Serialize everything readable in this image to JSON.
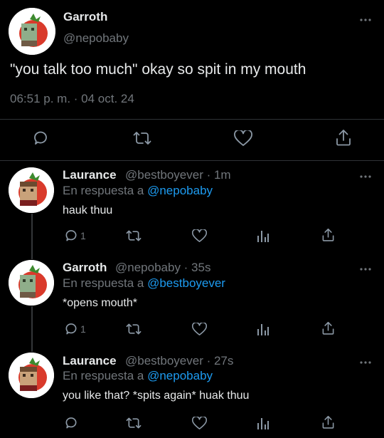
{
  "main": {
    "author_name": "Garroth",
    "author_handle": "@nepobaby",
    "text": "\"you talk too much\" okay so spit in my mouth",
    "timestamp": "06:51 p. m. · 04 oct. 24"
  },
  "replies": [
    {
      "name": "Laurance",
      "handle_time": "@bestboyever · 1m",
      "reply_prefix": "En respuesta a",
      "reply_to": "@nepobaby",
      "text": "hauk thuu",
      "reply_count": "1"
    },
    {
      "name": "Garroth",
      "handle_time": "@nepobaby · 35s",
      "reply_prefix": "En respuesta a",
      "reply_to": "@bestboyever",
      "text": "*opens mouth*",
      "reply_count": "1"
    },
    {
      "name": "Laurance",
      "handle_time": "@bestboyever · 27s",
      "reply_prefix": "En respuesta a",
      "reply_to": "@nepobaby",
      "text": "you like that? *spits again* huak thuu",
      "reply_count": ""
    }
  ],
  "icons": {
    "more": "more-icon",
    "reply": "comment-icon",
    "retweet": "retweet-icon",
    "like": "heart-icon",
    "share": "share-icon",
    "views": "views-icon"
  },
  "colors": {
    "background": "#000000",
    "text": "#e7e9ea",
    "muted": "#71767b",
    "link": "#1d9bf0",
    "divider": "#2f3336"
  }
}
